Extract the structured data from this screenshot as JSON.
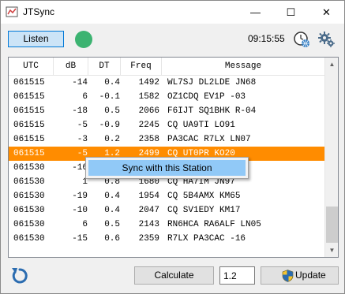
{
  "window": {
    "title": "JTSync",
    "minimize": "—",
    "maximize": "☐",
    "close": "✕"
  },
  "toolbar": {
    "listen_label": "Listen",
    "clock": "09:15:55"
  },
  "colors": {
    "status_dot": "#3cb371",
    "selected_row": "#ff8c00",
    "menu_highlight": "#91c9f7"
  },
  "grid": {
    "columns": [
      "UTC",
      "dB",
      "DT",
      "Freq",
      "Message"
    ],
    "rows": [
      {
        "utc": "061515",
        "db": "-14",
        "dt": "0.4",
        "freq": "1492",
        "msg": "WL7SJ DL2LDE JN68"
      },
      {
        "utc": "061515",
        "db": "6",
        "dt": "-0.1",
        "freq": "1582",
        "msg": "OZ1CDQ EV1P -03"
      },
      {
        "utc": "061515",
        "db": "-18",
        "dt": "0.5",
        "freq": "2066",
        "msg": "F6IJT SQ1BHK R-04"
      },
      {
        "utc": "061515",
        "db": "-5",
        "dt": "-0.9",
        "freq": "2245",
        "msg": "CQ UA9TI LO91"
      },
      {
        "utc": "061515",
        "db": "-3",
        "dt": "0.2",
        "freq": "2358",
        "msg": "PA3CAC R7LX LN07"
      },
      {
        "utc": "061515",
        "db": "-5",
        "dt": "1.2",
        "freq": "2499",
        "msg": "CQ UT0PR KO20"
      },
      {
        "utc": "061530",
        "db": "-16",
        "dt": "",
        "freq": "",
        "msg": ""
      },
      {
        "utc": "061530",
        "db": "1",
        "dt": "0.8",
        "freq": "1680",
        "msg": "CQ HA7IM JN97"
      },
      {
        "utc": "061530",
        "db": "-19",
        "dt": "0.4",
        "freq": "1954",
        "msg": "CQ 5B4AMX KM65"
      },
      {
        "utc": "061530",
        "db": "-10",
        "dt": "0.4",
        "freq": "2047",
        "msg": "CQ SV1EDY KM17"
      },
      {
        "utc": "061530",
        "db": "6",
        "dt": "0.5",
        "freq": "2143",
        "msg": "RN6HCA RA6ALF LN05"
      },
      {
        "utc": "061530",
        "db": "-15",
        "dt": "0.6",
        "freq": "2359",
        "msg": "R7LX PA3CAC -16"
      }
    ],
    "selected_index": 5
  },
  "context_menu": {
    "item_label": "Sync with this Station"
  },
  "bottom": {
    "calculate_label": "Calculate",
    "input_value": "1.2",
    "update_label": "Update"
  },
  "icons": [
    "app-icon",
    "clock-globe-icon",
    "gear-icon",
    "refresh-icon",
    "shield-icon"
  ]
}
